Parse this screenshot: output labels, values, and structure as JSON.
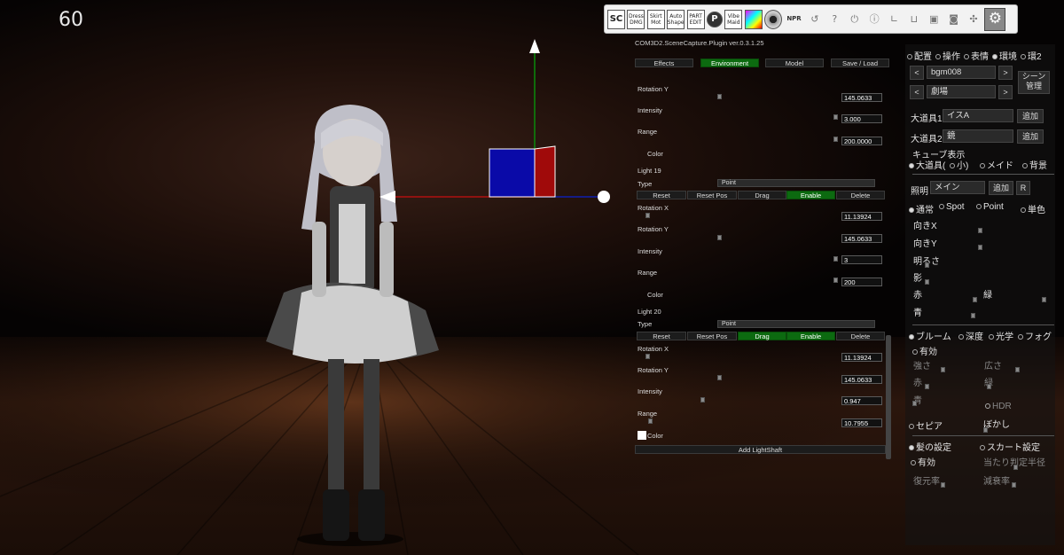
{
  "overlay": {
    "fps": "60"
  },
  "toolbar": {
    "items": [
      {
        "icon": "sc-icon",
        "label": "SC"
      },
      {
        "icon": "dress-dmg-icon",
        "label": "Dress DMG"
      },
      {
        "icon": "skirt-mot-icon",
        "label": "Skirt Mot"
      },
      {
        "icon": "auto-shape-icon",
        "label": "Auto Shape"
      },
      {
        "icon": "part-edit-icon",
        "label": "PART EDIT"
      },
      {
        "icon": "p-icon",
        "label": "P"
      },
      {
        "icon": "vibe-maid-icon",
        "label": "Vibe Maid"
      },
      {
        "icon": "color-gradient-icon",
        "label": ""
      },
      {
        "icon": "eye-icon",
        "label": ""
      },
      {
        "icon": "npr-icon",
        "label": "NPR"
      },
      {
        "icon": "undo-icon",
        "label": "↺"
      },
      {
        "icon": "help-icon",
        "label": "?"
      },
      {
        "icon": "power-icon",
        "label": "⏻"
      },
      {
        "icon": "info-icon",
        "label": "ⓘ"
      },
      {
        "icon": "graph-icon",
        "label": "∟"
      },
      {
        "icon": "basket-icon",
        "label": "⊔"
      },
      {
        "icon": "save-icon",
        "label": "▣"
      },
      {
        "icon": "camera-icon",
        "label": "◙"
      },
      {
        "icon": "plugin-icon",
        "label": "✣"
      },
      {
        "icon": "gear-icon",
        "label": "⚙"
      }
    ]
  },
  "scene_panel": {
    "title": "COM3D2.SceneCapture.Plugin ver.0.3.1.25",
    "tabs": [
      "Effects",
      "Environment",
      "Model",
      "Save / Load"
    ],
    "active_tab": "Environment",
    "top": {
      "rotation_y_label": "Rotation Y",
      "rotation_y_value": "145.0633",
      "intensity_label": "Intensity",
      "intensity_value": "3.000",
      "range_label": "Range",
      "range_value": "200.0000",
      "color_label": "Color"
    },
    "lights": [
      {
        "name": "Light 19",
        "type_label": "Type",
        "type_value": "Point",
        "buttons": [
          "Reset",
          "Reset Pos",
          "Drag",
          "Enable",
          "Delete"
        ],
        "rotation_x_label": "Rotation X",
        "rotation_x_value": "11.13924",
        "rotation_y_label": "Rotation Y",
        "rotation_y_value": "145.0633",
        "intensity_label": "Intensity",
        "intensity_value": "3",
        "range_label": "Range",
        "range_value": "200",
        "color_label": "Color"
      },
      {
        "name": "Light 20",
        "type_label": "Type",
        "type_value": "Point",
        "buttons": [
          "Reset",
          "Reset Pos",
          "Drag",
          "Enable",
          "Delete"
        ],
        "rotation_x_label": "Rotation X",
        "rotation_x_value": "11.13924",
        "rotation_y_label": "Rotation Y",
        "rotation_y_value": "145.0633",
        "intensity_label": "Intensity",
        "intensity_value": "0.947",
        "range_label": "Range",
        "range_value": "10.7955",
        "color_label": "Color"
      }
    ],
    "add_button": "Add LightShaft"
  },
  "side_panel": {
    "tabs": [
      "配置",
      "操作",
      "表情",
      "環境",
      "環2"
    ],
    "bgm": "bgm008",
    "stage": "劇場",
    "scene_button": "シーン 管理",
    "prev": "<",
    "next": ">",
    "prop1_label": "大道具1",
    "prop1_value": "イスA",
    "prop2_label": "大道具2",
    "prop2_value": "鏡",
    "add": "追加",
    "cube_label": "キューブ表示",
    "cube_options": [
      "大道具(",
      "小)",
      "メイド",
      "背景"
    ],
    "light_label": "照明",
    "light_value": "メイン",
    "r_button": "R",
    "light_types": [
      "通常",
      "Spot",
      "Point",
      "単色"
    ],
    "light_params": [
      "向きX",
      "向きY",
      "明るさ",
      "影",
      "赤",
      "緑",
      "青"
    ],
    "effect_tabs": [
      "ブルーム",
      "深度",
      "光学",
      "フォグ"
    ],
    "enabled": "有効",
    "bloom_params": [
      "強さ",
      "広さ",
      "赤",
      "緑",
      "青",
      "HDR"
    ],
    "sepia": "セピア",
    "blur": "ぼかし",
    "hair_settings": "髪の設定",
    "skirt_settings": "スカート設定",
    "hair_enabled": "有効",
    "hit_radius": "当たり判定半径",
    "restore": "復元率",
    "decay": "減衰率"
  }
}
